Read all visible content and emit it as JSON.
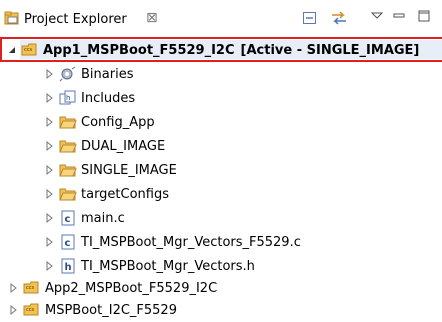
{
  "view": {
    "tab_title": "Project Explorer",
    "tab_close_glyph": "⊠",
    "toolbar": [
      {
        "name": "collapse-all-icon"
      },
      {
        "name": "link-with-editor-icon"
      },
      {
        "name": "view-menu-icon"
      },
      {
        "name": "minimize-icon"
      },
      {
        "name": "maximize-icon"
      }
    ]
  },
  "tree": {
    "project_active": {
      "label": "App1_MSPBoot_F5529_I2C",
      "status": "[Active - SINGLE_IMAGE]",
      "expanded": true,
      "icon": "ccs-project-icon",
      "selected": true
    },
    "children": [
      {
        "label": "Binaries",
        "icon": "binaries-icon"
      },
      {
        "label": "Includes",
        "icon": "includes-icon"
      },
      {
        "label": "Config_App",
        "icon": "folder-icon"
      },
      {
        "label": "DUAL_IMAGE",
        "icon": "folder-icon"
      },
      {
        "label": "SINGLE_IMAGE",
        "icon": "folder-icon"
      },
      {
        "label": "targetConfigs",
        "icon": "folder-icon"
      },
      {
        "label": "main.c",
        "icon": "c-file-icon"
      },
      {
        "label": "TI_MSPBoot_Mgr_Vectors_F5529.c",
        "icon": "c-file-icon"
      },
      {
        "label": "TI_MSPBoot_Mgr_Vectors.h",
        "icon": "h-file-icon"
      }
    ],
    "projects": [
      {
        "label": "App2_MSPBoot_F5529_I2C",
        "icon": "ccs-project-icon"
      },
      {
        "label": "MSPBoot_I2C_F5529",
        "icon": "ccs-project-icon"
      }
    ]
  },
  "colors": {
    "highlight_border": "#e0201e",
    "folder": "#f2c14e",
    "selection": "#e8eef8"
  }
}
